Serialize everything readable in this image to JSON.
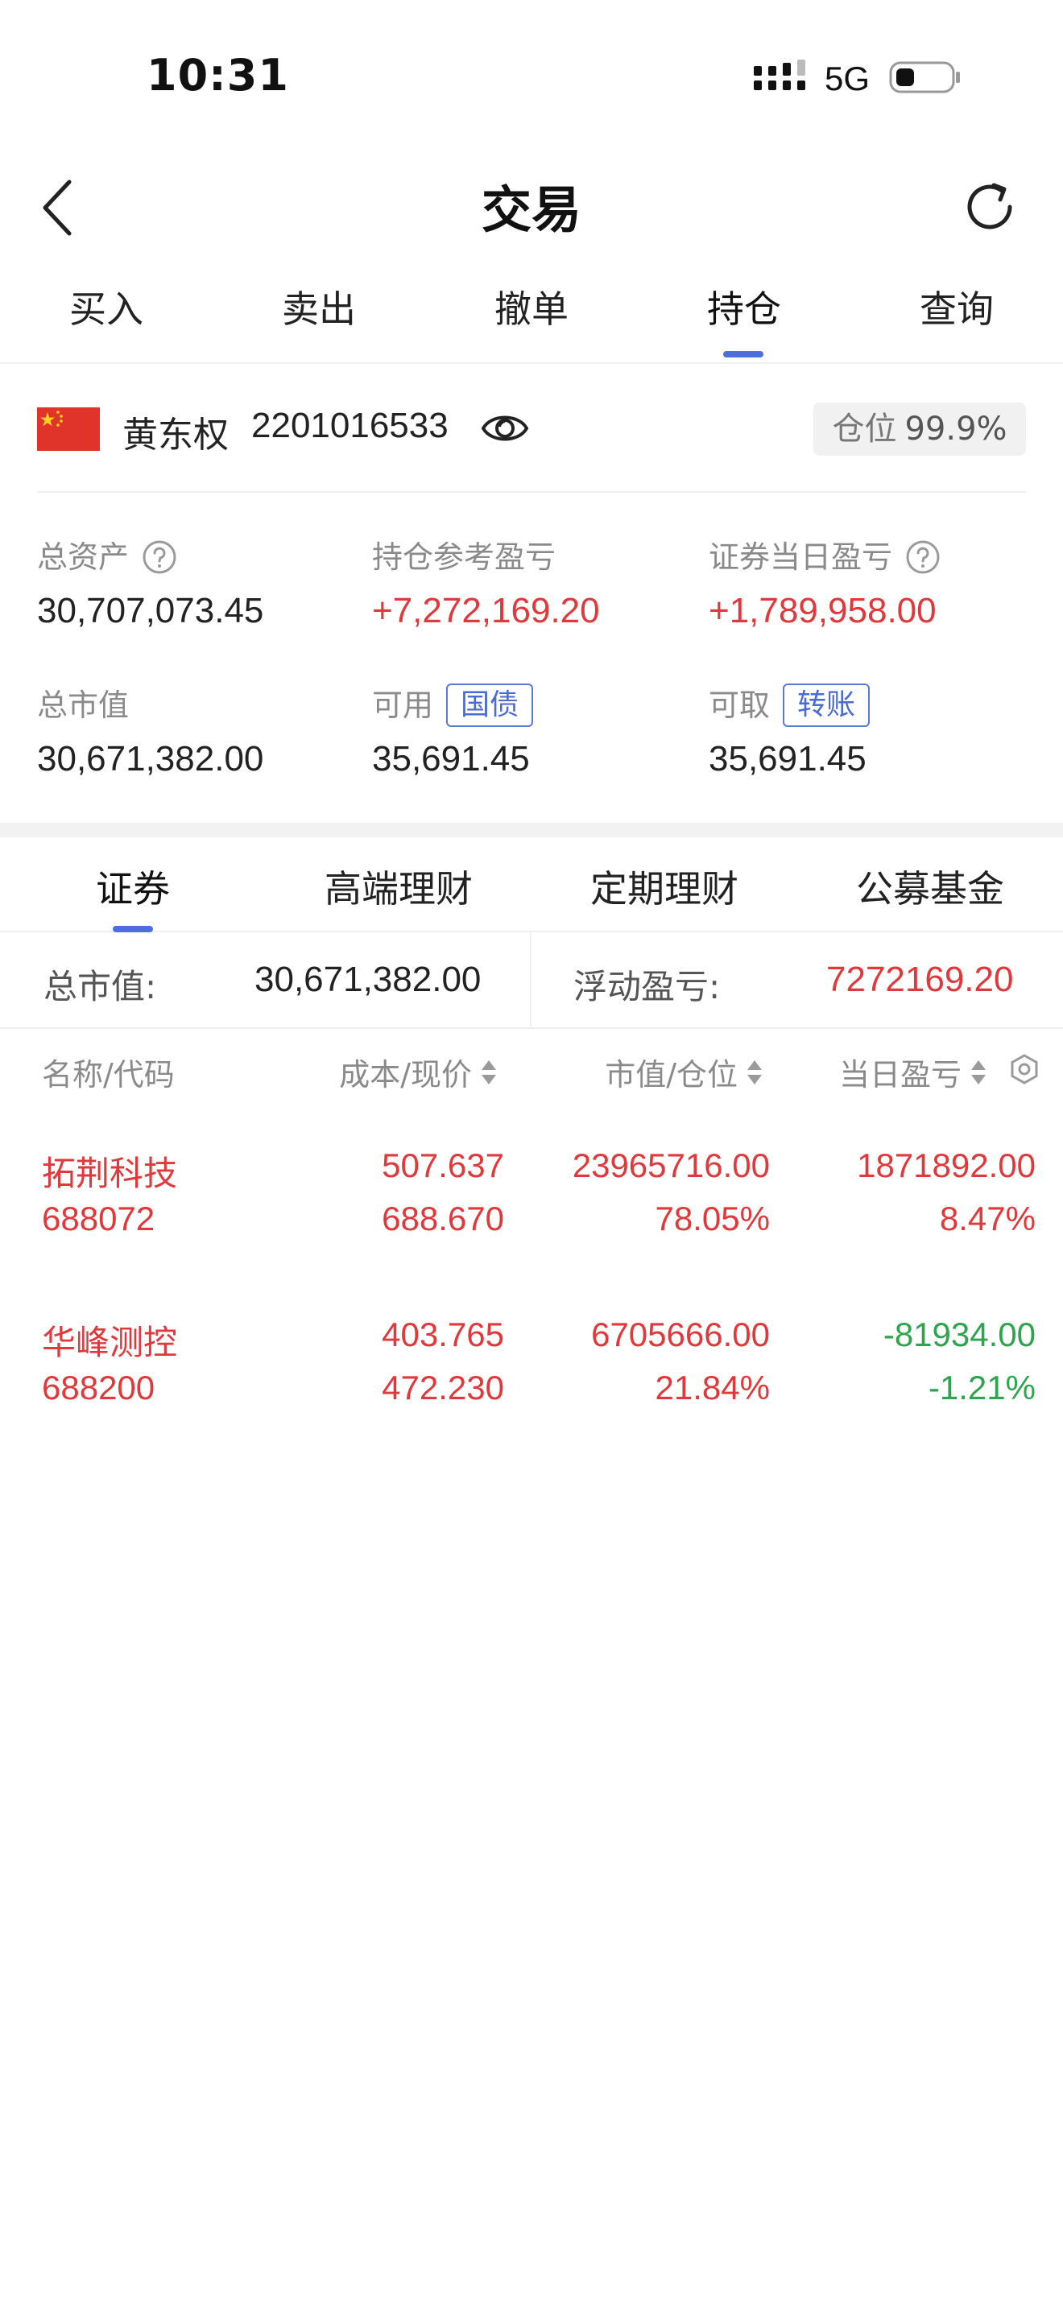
{
  "status_bar": {
    "time": "10:31",
    "network": "5G"
  },
  "header": {
    "title": "交易"
  },
  "top_tabs": [
    {
      "label": "买入"
    },
    {
      "label": "卖出"
    },
    {
      "label": "撤单"
    },
    {
      "label": "持仓"
    },
    {
      "label": "查询"
    }
  ],
  "top_tabs_active": "持仓",
  "account": {
    "name": "黄东权",
    "id": "2201016533",
    "position_label": "仓位",
    "position_value": "99.9%"
  },
  "summary": {
    "total_assets": {
      "label": "总资产",
      "value": "30,707,073.45"
    },
    "holding_pnl": {
      "label": "持仓参考盈亏",
      "value": "+7,272,169.20"
    },
    "daily_pnl": {
      "label": "证券当日盈亏",
      "value": "+1,789,958.00"
    },
    "market_value": {
      "label": "总市值",
      "value": "30,671,382.00"
    },
    "available": {
      "label": "可用",
      "chip": "国债",
      "value": "35,691.45"
    },
    "withdrawable": {
      "label": "可取",
      "chip": "转账",
      "value": "35,691.45"
    }
  },
  "sub_tabs": [
    {
      "label": "证券"
    },
    {
      "label": "高端理财"
    },
    {
      "label": "定期理财"
    },
    {
      "label": "公募基金"
    }
  ],
  "sub_tabs_active": "证券",
  "totals": {
    "market_value_label": "总市值:",
    "market_value": "30,671,382.00",
    "floating_pnl_label": "浮动盈亏:",
    "floating_pnl": "7272169.20"
  },
  "columns": {
    "name_code": "名称/代码",
    "cost_price": "成本/现价",
    "value_position": "市值/仓位",
    "daily_pnl": "当日盈亏"
  },
  "holdings": [
    {
      "name": "拓荆科技",
      "code": "688072",
      "cost": "507.637",
      "price": "688.670",
      "market_value": "23965716.00",
      "position": "78.05%",
      "daily_pnl": "1871892.00",
      "daily_pnl_pct": "8.47%"
    },
    {
      "name": "华峰测控",
      "code": "688200",
      "cost": "403.765",
      "price": "472.230",
      "market_value": "6705666.00",
      "position": "21.84%",
      "daily_pnl": "-81934.00",
      "daily_pnl_pct": "-1.21%"
    }
  ],
  "colors": {
    "accent": "#4d6fde",
    "gain": "#e0383b",
    "loss": "#2ea44f"
  }
}
